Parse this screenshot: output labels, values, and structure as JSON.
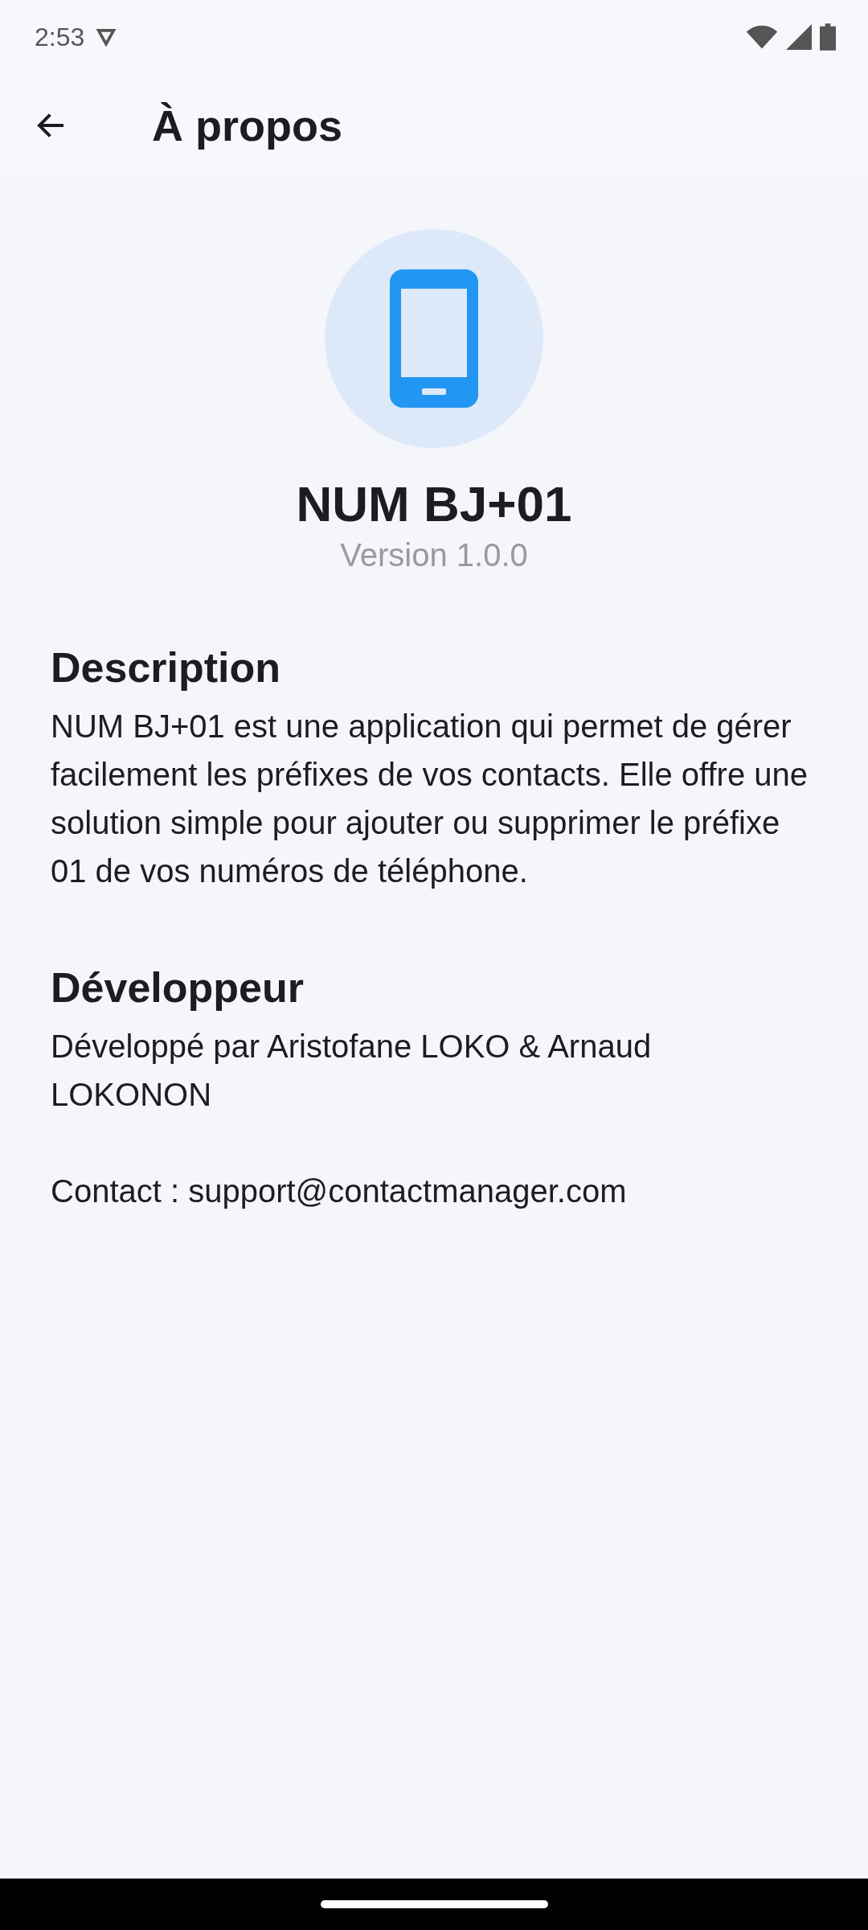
{
  "status_bar": {
    "time": "2:53"
  },
  "app_bar": {
    "title": "À propos"
  },
  "app_info": {
    "name": "NUM BJ+01",
    "version": "Version 1.0.0"
  },
  "sections": [
    {
      "heading": "Description",
      "paragraphs": [
        "NUM BJ+01 est une application qui permet de gérer facilement les préfixes de vos contacts. Elle offre une solution simple pour ajouter ou supprimer le préfixe 01 de vos numéros de téléphone."
      ]
    },
    {
      "heading": "Développeur",
      "paragraphs": [
        "Développé par Aristofane LOKO & Arnaud LOKONON",
        "Contact : support@contactmanager.com"
      ]
    }
  ]
}
